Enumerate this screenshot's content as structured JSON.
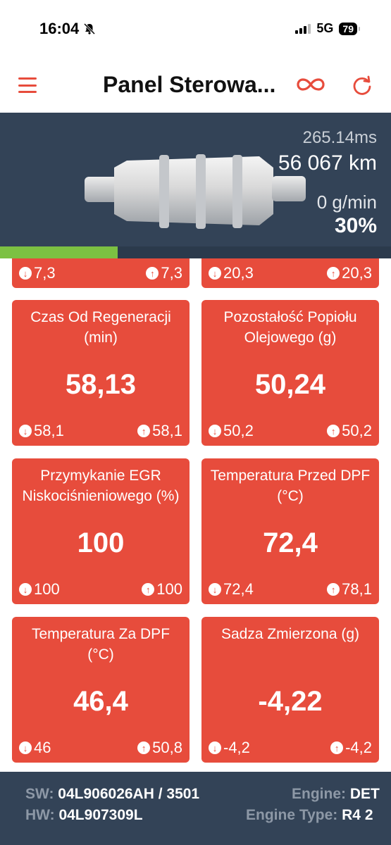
{
  "status": {
    "time": "16:04",
    "network": "5G",
    "battery": "79"
  },
  "header": {
    "title": "Panel Sterowa..."
  },
  "hero": {
    "latency": "265.14ms",
    "distance": "56 067 km",
    "flow": "0 g/min",
    "percent": "30%",
    "progress": 0.3
  },
  "cards": [
    {
      "title": "",
      "value": "",
      "min": "7,3",
      "max": "7,3"
    },
    {
      "title": "",
      "value": "",
      "min": "20,3",
      "max": "20,3"
    },
    {
      "title": "Czas Od Regeneracji (min)",
      "value": "58,13",
      "min": "58,1",
      "max": "58,1"
    },
    {
      "title": "Pozostałość Popiołu Olejowego (g)",
      "value": "50,24",
      "min": "50,2",
      "max": "50,2"
    },
    {
      "title": "Przymykanie EGR Niskociśnieniowego (%)",
      "value": "100",
      "min": "100",
      "max": "100"
    },
    {
      "title": "Temperatura Przed DPF (°C)",
      "value": "72,4",
      "min": "72,4",
      "max": "78,1"
    },
    {
      "title": "Temperatura Za DPF (°C)",
      "value": "46,4",
      "min": "46",
      "max": "50,8"
    },
    {
      "title": "Sadza Zmierzona (g)",
      "value": "-4,22",
      "min": "-4,2",
      "max": "-4,2"
    }
  ],
  "footer": {
    "sw_label": "SW:",
    "sw_value": "04L906026AH / 3501",
    "hw_label": "HW:",
    "hw_value": "04L907309L",
    "engine_label": "Engine:",
    "engine_value": "DET",
    "engine_type_label": "Engine Type:",
    "engine_type_value": "R4 2"
  },
  "colors": {
    "accent": "#e74c3c",
    "header_bg": "#334357",
    "progress": "#7cc142"
  },
  "icons": {
    "menu": "hamburger-icon",
    "link": "infinity-link-icon",
    "refresh": "refresh-icon",
    "min": "arrow-down-circle-icon",
    "max": "arrow-up-circle-icon"
  }
}
